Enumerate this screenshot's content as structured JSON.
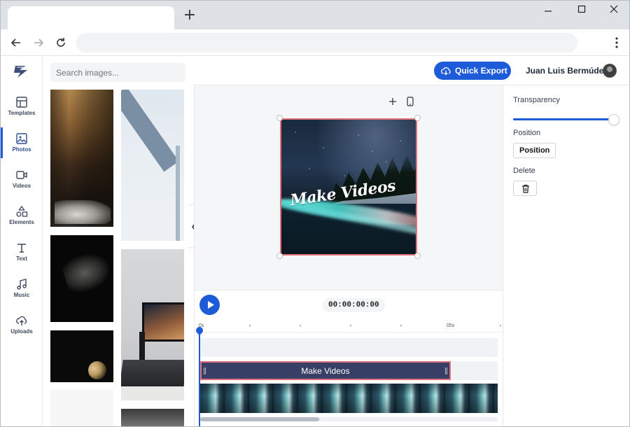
{
  "browser": {
    "new_tab_glyph": "+",
    "icons": [
      "back-arrow-icon",
      "forward-arrow-icon",
      "reload-icon",
      "more-vert-icon",
      "minimize-icon",
      "maximize-icon",
      "close-icon"
    ]
  },
  "nav": {
    "items": [
      {
        "label": "Templates",
        "icon": "templates-icon"
      },
      {
        "label": "Photos",
        "icon": "photos-icon",
        "active": true
      },
      {
        "label": "Videos",
        "icon": "videos-icon"
      },
      {
        "label": "Elements",
        "icon": "elements-icon"
      },
      {
        "label": "Text",
        "icon": "text-icon"
      },
      {
        "label": "Music",
        "icon": "music-icon"
      },
      {
        "label": "Uploads",
        "icon": "uploads-icon"
      }
    ]
  },
  "photos": {
    "search_placeholder": "Search images..."
  },
  "header": {
    "export_label": "Quick Export",
    "user_name": "Juan Luis Bermúdez"
  },
  "canvas": {
    "overlay_text": "Make Videos"
  },
  "timeline": {
    "timecode": "00:00:00:00",
    "ruler_start": "0s",
    "ruler_mid": "05s",
    "text_clip_label": "Make Videos"
  },
  "properties": {
    "transparency_label": "Transparency",
    "transparency_value": 1.0,
    "position_label": "Position",
    "position_button": "Position",
    "delete_label": "Delete"
  },
  "colors": {
    "accent": "#1d5bd8",
    "selection": "#e0707a",
    "clip_bg": "#383f66"
  }
}
